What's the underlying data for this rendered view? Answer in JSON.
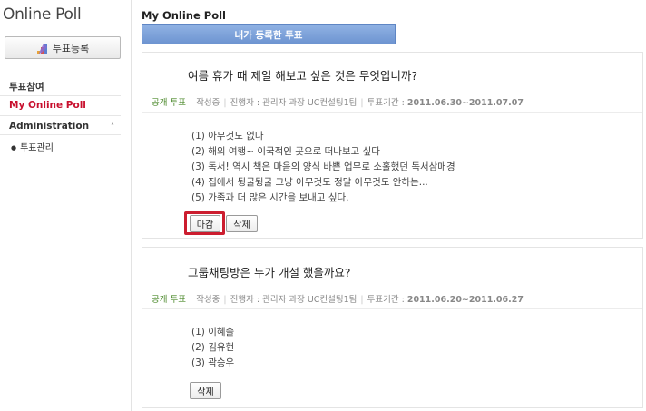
{
  "sidebar": {
    "app_title": "Online Poll",
    "register_button": "투표등록",
    "register_icon": "pencil-icon",
    "items": [
      {
        "label": "투표참여"
      },
      {
        "label": "My Online Poll"
      }
    ],
    "admin": {
      "label": "Administration",
      "chevron": "˄"
    },
    "sub_items": [
      {
        "label": "투표관리"
      }
    ]
  },
  "main": {
    "title": "My Online Poll",
    "tab": "내가 등록한 투표"
  },
  "polls": [
    {
      "question": "여름 휴가 때 제일 해보고 싶은 것은 무엇입니까?",
      "badge": "공개 투표",
      "status": "작성중",
      "owner": "진행자 : 관리자 과장 UC컨설팅1팀",
      "period_label": "투표기간 : ",
      "period": "2011.06.30~2011.07.07",
      "options": [
        "(1) 아무것도 없다",
        "(2) 해외 여행~ 이국적인 곳으로 떠나보고 싶다",
        "(3) 독서! 역시 책은 마음의 양식 바쁜 업무로 소홀했던 독서삼매경",
        "(4) 집에서 뒹굴뒹굴 그냥 아무것도 정말 아무것도 안하는...",
        "(5) 가족과 더 많은 시간을 보내고 싶다."
      ],
      "close_button": "마감",
      "delete_button": "삭제"
    },
    {
      "question": "그룹채팅방은 누가 개설 했을까요?",
      "badge": "공개 투표",
      "status": "작성중",
      "owner": "진행자 : 관리자 과장 UC컨설팅1팀",
      "period_label": "투표기간 : ",
      "period": "2011.06.20~2011.06.27",
      "options": [
        "(1) 이혜솔",
        "(2) 김유현",
        "(3) 곽승우"
      ],
      "delete_button": "삭제"
    }
  ],
  "colors": {
    "accent_tab": "#7aa0da",
    "active_nav": "#c8102e",
    "badge_green": "#4c8a2c",
    "highlight_red": "#cc1d2f"
  }
}
